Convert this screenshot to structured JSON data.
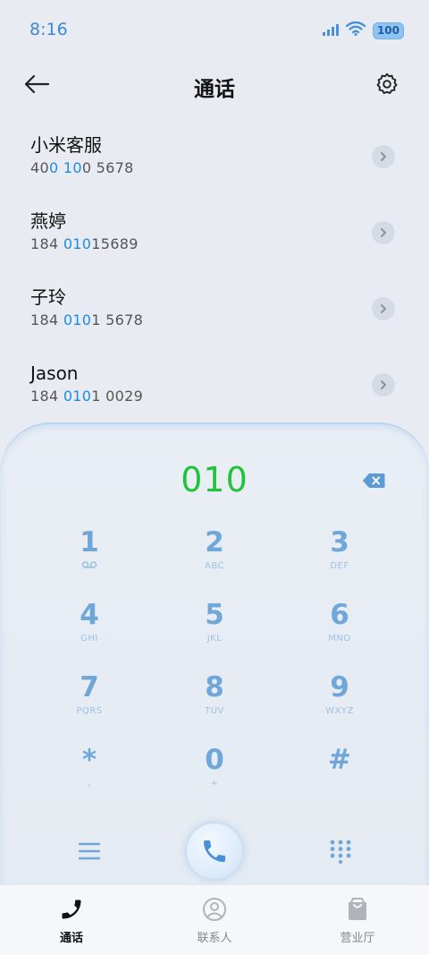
{
  "status": {
    "time": "8:16",
    "battery": "100"
  },
  "header": {
    "title": "通话"
  },
  "contacts": [
    {
      "name": "小米客服",
      "num_pre": "40",
      "num_hl1": "0",
      "num_mid": " ",
      "num_hl2": "10",
      "num_post": "0 5678"
    },
    {
      "name": "燕婷",
      "num_pre": "184 ",
      "num_hl1": "010",
      "num_mid": "",
      "num_hl2": "",
      "num_post": "15689"
    },
    {
      "name": "子玲",
      "num_pre": "184 ",
      "num_hl1": "010",
      "num_mid": "",
      "num_hl2": "",
      "num_post": "1 5678"
    },
    {
      "name": "Jason",
      "num_pre": "184 ",
      "num_hl1": "010",
      "num_mid": "",
      "num_hl2": "",
      "num_post": "1 0029"
    }
  ],
  "dialer": {
    "input": "010",
    "keys": [
      {
        "digit": "1",
        "letters": ""
      },
      {
        "digit": "2",
        "letters": "ABC"
      },
      {
        "digit": "3",
        "letters": "DEF"
      },
      {
        "digit": "4",
        "letters": "GHI"
      },
      {
        "digit": "5",
        "letters": "JKL"
      },
      {
        "digit": "6",
        "letters": "MNO"
      },
      {
        "digit": "7",
        "letters": "PQRS"
      },
      {
        "digit": "8",
        "letters": "TUV"
      },
      {
        "digit": "9",
        "letters": "WXYZ"
      },
      {
        "digit": "*",
        "letters": ","
      },
      {
        "digit": "0",
        "letters": "+"
      },
      {
        "digit": "#",
        "letters": ""
      }
    ]
  },
  "nav": {
    "calls": "通话",
    "contacts": "联系人",
    "hall": "营业厅"
  },
  "colors": {
    "accent_blue": "#1a8ce0",
    "dial_green": "#1fc43a",
    "key_blue": "#6fa7da"
  }
}
